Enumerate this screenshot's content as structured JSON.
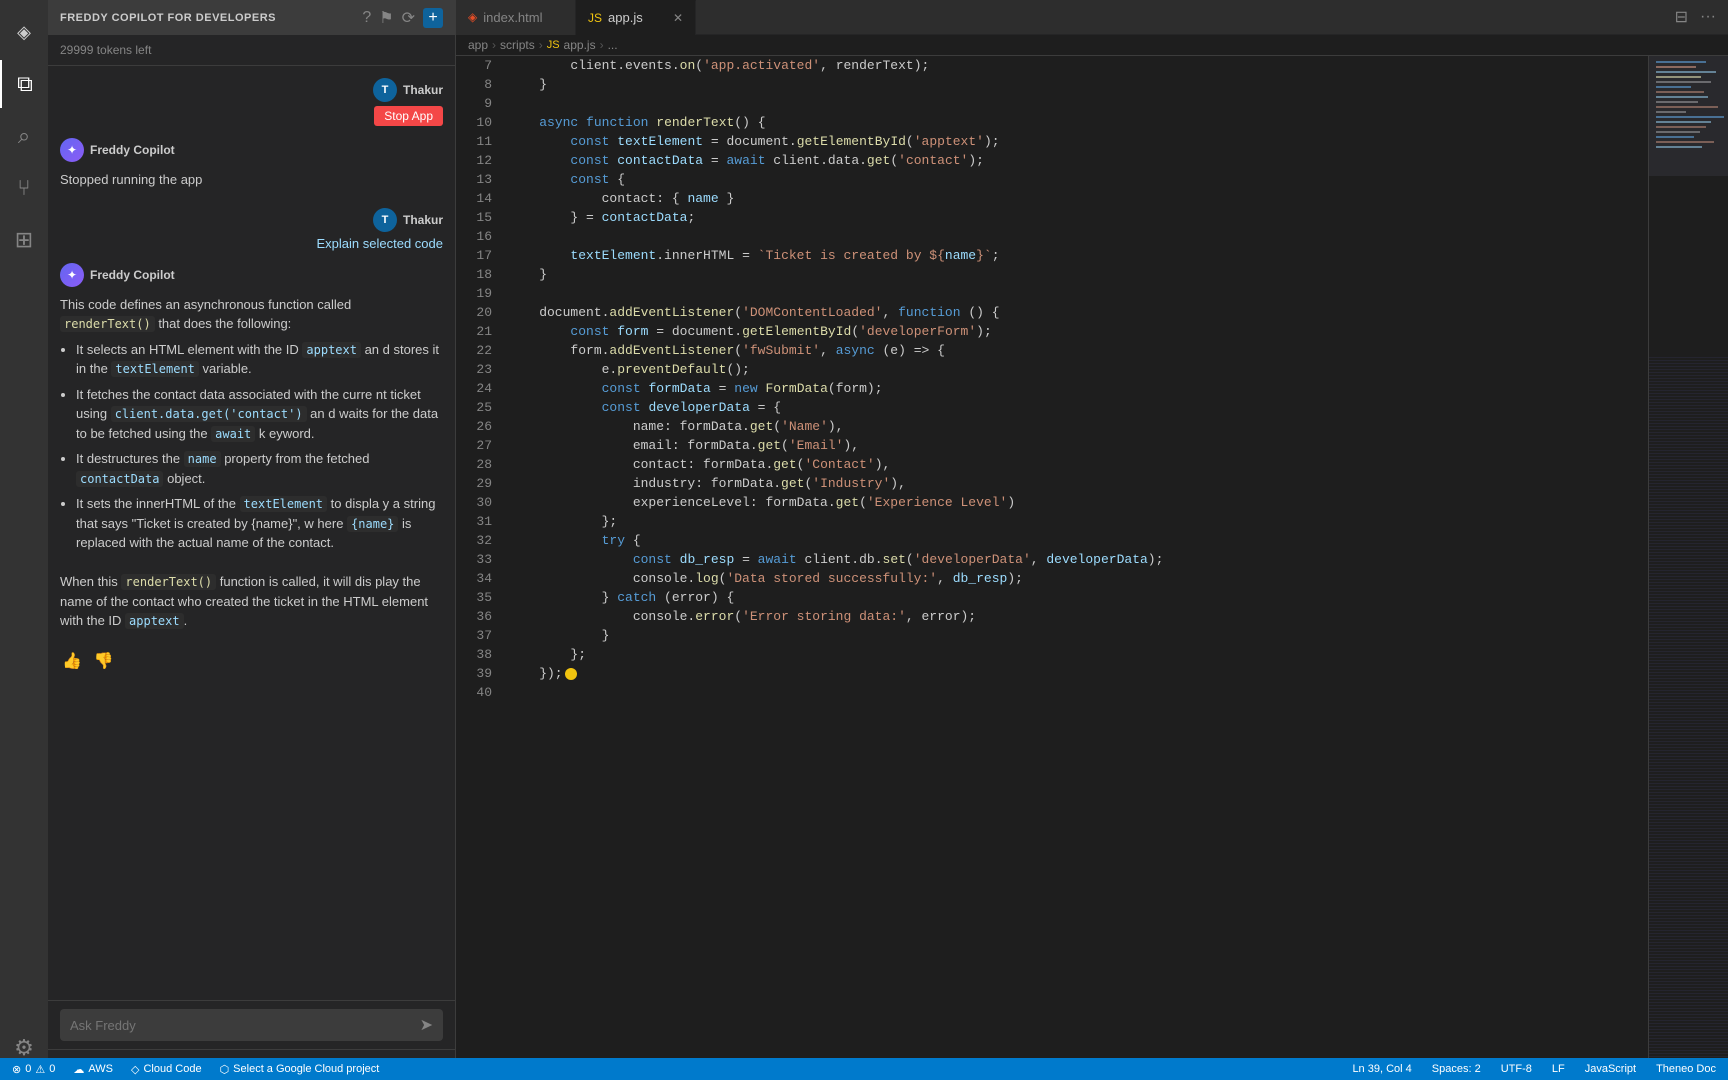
{
  "app": {
    "title": "FREDDY COPILOT FOR DEVELOPERS",
    "tokens_label": "29999 tokens left"
  },
  "activity_bar": {
    "items": [
      {
        "name": "logo",
        "icon": "◈"
      },
      {
        "name": "explorer",
        "icon": "⧉"
      },
      {
        "name": "search",
        "icon": "⌕"
      },
      {
        "name": "source-control",
        "icon": "⑂"
      },
      {
        "name": "extensions",
        "icon": "⊞"
      },
      {
        "name": "settings-bottom",
        "icon": "⚙"
      }
    ]
  },
  "sidebar": {
    "title": "FREDDY COPILOT FOR DEVELOPERS",
    "tokens": "29999 tokens left",
    "messages": [
      {
        "type": "user",
        "avatar": "T",
        "name": "Thakur",
        "action": "Stop App"
      },
      {
        "type": "freddy",
        "name": "Freddy Copilot",
        "content": "Stopped running the app"
      },
      {
        "type": "user",
        "avatar": "T",
        "name": "Thakur",
        "action": "Explain selected code"
      },
      {
        "type": "freddy",
        "name": "Freddy Copilot",
        "intro": "This code defines an asynchronous function called",
        "intro_code": "renderText()",
        "intro_end": " that does the following:",
        "bullets": [
          {
            "text": "It selects an HTML element with the ID",
            "code1": "apptext",
            "mid": "an d stores it in the",
            "code2": "textElement",
            "end": "variable."
          },
          {
            "text": "It fetches the contact data associated with the curre nt ticket using",
            "code1": "client.data.get('contact')",
            "mid": "an d waits for the data to be fetched using the",
            "code2": "await",
            "end": "k eyword."
          },
          {
            "text": "It destructures the",
            "code1": "name",
            "mid": "property from the fetched",
            "code2": "contactData",
            "end": "object."
          },
          {
            "text": "It sets the innerHTML of the",
            "code1": "textElement",
            "mid": "to displa y a string that says \"Ticket is created by {name}\", w here",
            "code2": "{name}",
            "end": "is replaced with the actual name of the contact."
          }
        ],
        "outro1": "When this",
        "outro_code": "renderText()",
        "outro2": "function is called, it will dis play the name of the contact who created the ticket in the HTML element with the ID",
        "outro_code2": "apptext",
        "outro3": "."
      }
    ],
    "ask_placeholder": "Ask Freddy"
  },
  "editor": {
    "tabs": [
      {
        "name": "index.html",
        "type": "html",
        "active": false
      },
      {
        "name": "app.js",
        "type": "js",
        "active": true
      }
    ],
    "breadcrumb": [
      "app",
      "scripts",
      "app.js",
      "..."
    ],
    "lines": [
      {
        "num": 7,
        "tokens": [
          {
            "t": "        client.events.on(",
            "c": "plain"
          },
          {
            "t": "'app.activated'",
            "c": "str"
          },
          {
            "t": ", renderText);",
            "c": "plain"
          }
        ]
      },
      {
        "num": 8,
        "tokens": [
          {
            "t": "    }",
            "c": "plain"
          }
        ]
      },
      {
        "num": 9,
        "tokens": []
      },
      {
        "num": 10,
        "tokens": [
          {
            "t": "    ",
            "c": "plain"
          },
          {
            "t": "async",
            "c": "kw"
          },
          {
            "t": " ",
            "c": "plain"
          },
          {
            "t": "function",
            "c": "kw"
          },
          {
            "t": " ",
            "c": "plain"
          },
          {
            "t": "renderText",
            "c": "fn"
          },
          {
            "t": "() {",
            "c": "plain"
          }
        ]
      },
      {
        "num": 11,
        "tokens": [
          {
            "t": "        ",
            "c": "plain"
          },
          {
            "t": "const",
            "c": "kw"
          },
          {
            "t": " ",
            "c": "plain"
          },
          {
            "t": "textElement",
            "c": "var-name"
          },
          {
            "t": " = document.",
            "c": "plain"
          },
          {
            "t": "getElementById",
            "c": "fn"
          },
          {
            "t": "(",
            "c": "plain"
          },
          {
            "t": "'apptext'",
            "c": "str"
          },
          {
            "t": ");",
            "c": "plain"
          }
        ]
      },
      {
        "num": 12,
        "tokens": [
          {
            "t": "        ",
            "c": "plain"
          },
          {
            "t": "const",
            "c": "kw"
          },
          {
            "t": " ",
            "c": "plain"
          },
          {
            "t": "contactData",
            "c": "var-name"
          },
          {
            "t": " = ",
            "c": "plain"
          },
          {
            "t": "await",
            "c": "kw"
          },
          {
            "t": " client.data.",
            "c": "plain"
          },
          {
            "t": "get",
            "c": "fn"
          },
          {
            "t": "(",
            "c": "plain"
          },
          {
            "t": "'contact'",
            "c": "str"
          },
          {
            "t": ");",
            "c": "plain"
          }
        ]
      },
      {
        "num": 13,
        "tokens": [
          {
            "t": "        ",
            "c": "plain"
          },
          {
            "t": "const",
            "c": "kw"
          },
          {
            "t": " {",
            "c": "plain"
          }
        ]
      },
      {
        "num": 14,
        "tokens": [
          {
            "t": "            contact: { ",
            "c": "plain"
          },
          {
            "t": "name",
            "c": "var-name"
          },
          {
            "t": " }",
            "c": "plain"
          }
        ]
      },
      {
        "num": 15,
        "tokens": [
          {
            "t": "        } = ",
            "c": "plain"
          },
          {
            "t": "contactData",
            "c": "var-name"
          },
          {
            "t": ";",
            "c": "plain"
          }
        ]
      },
      {
        "num": 16,
        "tokens": []
      },
      {
        "num": 17,
        "tokens": [
          {
            "t": "        ",
            "c": "plain"
          },
          {
            "t": "textElement",
            "c": "var-name"
          },
          {
            "t": ".innerHTML = ",
            "c": "plain"
          },
          {
            "t": "`Ticket is created by ${",
            "c": "str"
          },
          {
            "t": "name",
            "c": "var-name"
          },
          {
            "t": "}`",
            "c": "str"
          },
          {
            "t": ";",
            "c": "plain"
          }
        ]
      },
      {
        "num": 18,
        "tokens": [
          {
            "t": "    }",
            "c": "plain"
          }
        ]
      },
      {
        "num": 19,
        "tokens": []
      },
      {
        "num": 20,
        "tokens": [
          {
            "t": "    document.",
            "c": "plain"
          },
          {
            "t": "addEventListener",
            "c": "fn"
          },
          {
            "t": "(",
            "c": "plain"
          },
          {
            "t": "'DOMContentLoaded'",
            "c": "str"
          },
          {
            "t": ", ",
            "c": "plain"
          },
          {
            "t": "function",
            "c": "kw"
          },
          {
            "t": " () {",
            "c": "plain"
          }
        ]
      },
      {
        "num": 21,
        "tokens": [
          {
            "t": "        ",
            "c": "plain"
          },
          {
            "t": "const",
            "c": "kw"
          },
          {
            "t": " ",
            "c": "plain"
          },
          {
            "t": "form",
            "c": "var-name"
          },
          {
            "t": " = document.",
            "c": "plain"
          },
          {
            "t": "getElementById",
            "c": "fn"
          },
          {
            "t": "(",
            "c": "plain"
          },
          {
            "t": "'developerForm'",
            "c": "str"
          },
          {
            "t": ");",
            "c": "plain"
          }
        ]
      },
      {
        "num": 22,
        "tokens": [
          {
            "t": "        form.",
            "c": "plain"
          },
          {
            "t": "addEventListener",
            "c": "fn"
          },
          {
            "t": "(",
            "c": "plain"
          },
          {
            "t": "'fwSubmit'",
            "c": "str"
          },
          {
            "t": ", ",
            "c": "plain"
          },
          {
            "t": "async",
            "c": "kw"
          },
          {
            "t": " (e) => {",
            "c": "plain"
          }
        ]
      },
      {
        "num": 23,
        "tokens": [
          {
            "t": "            e.",
            "c": "plain"
          },
          {
            "t": "preventDefault",
            "c": "fn"
          },
          {
            "t": "();",
            "c": "plain"
          }
        ]
      },
      {
        "num": 24,
        "tokens": [
          {
            "t": "            ",
            "c": "plain"
          },
          {
            "t": "const",
            "c": "kw"
          },
          {
            "t": " ",
            "c": "plain"
          },
          {
            "t": "formData",
            "c": "var-name"
          },
          {
            "t": " = ",
            "c": "plain"
          },
          {
            "t": "new",
            "c": "kw"
          },
          {
            "t": " ",
            "c": "plain"
          },
          {
            "t": "FormData",
            "c": "fn"
          },
          {
            "t": "(form);",
            "c": "plain"
          }
        ]
      },
      {
        "num": 25,
        "tokens": [
          {
            "t": "            ",
            "c": "plain"
          },
          {
            "t": "const",
            "c": "kw"
          },
          {
            "t": " ",
            "c": "plain"
          },
          {
            "t": "developerData",
            "c": "var-name"
          },
          {
            "t": " = {",
            "c": "plain"
          }
        ]
      },
      {
        "num": 26,
        "tokens": [
          {
            "t": "                name: formData.",
            "c": "plain"
          },
          {
            "t": "get",
            "c": "fn"
          },
          {
            "t": "(",
            "c": "plain"
          },
          {
            "t": "'Name'",
            "c": "str"
          },
          {
            "t": "),",
            "c": "plain"
          }
        ]
      },
      {
        "num": 27,
        "tokens": [
          {
            "t": "                email: formData.",
            "c": "plain"
          },
          {
            "t": "get",
            "c": "fn"
          },
          {
            "t": "(",
            "c": "plain"
          },
          {
            "t": "'Email'",
            "c": "str"
          },
          {
            "t": "),",
            "c": "plain"
          }
        ]
      },
      {
        "num": 28,
        "tokens": [
          {
            "t": "                contact: formData.",
            "c": "plain"
          },
          {
            "t": "get",
            "c": "fn"
          },
          {
            "t": "(",
            "c": "plain"
          },
          {
            "t": "'Contact'",
            "c": "str"
          },
          {
            "t": "),",
            "c": "plain"
          }
        ]
      },
      {
        "num": 29,
        "tokens": [
          {
            "t": "                industry: formData.",
            "c": "plain"
          },
          {
            "t": "get",
            "c": "fn"
          },
          {
            "t": "(",
            "c": "plain"
          },
          {
            "t": "'Industry'",
            "c": "str"
          },
          {
            "t": "),",
            "c": "plain"
          }
        ]
      },
      {
        "num": 30,
        "tokens": [
          {
            "t": "                experienceLevel: formData.",
            "c": "plain"
          },
          {
            "t": "get",
            "c": "fn"
          },
          {
            "t": "(",
            "c": "plain"
          },
          {
            "t": "'Experience Level'",
            "c": "str"
          },
          {
            "t": ")",
            "c": "plain"
          }
        ]
      },
      {
        "num": 31,
        "tokens": [
          {
            "t": "            };",
            "c": "plain"
          }
        ]
      },
      {
        "num": 32,
        "tokens": [
          {
            "t": "            ",
            "c": "plain"
          },
          {
            "t": "try",
            "c": "kw"
          },
          {
            "t": " {",
            "c": "plain"
          }
        ]
      },
      {
        "num": 33,
        "tokens": [
          {
            "t": "                ",
            "c": "plain"
          },
          {
            "t": "const",
            "c": "kw"
          },
          {
            "t": " ",
            "c": "plain"
          },
          {
            "t": "db_resp",
            "c": "var-name"
          },
          {
            "t": " = ",
            "c": "plain"
          },
          {
            "t": "await",
            "c": "kw"
          },
          {
            "t": " client.db.",
            "c": "plain"
          },
          {
            "t": "set",
            "c": "fn"
          },
          {
            "t": "(",
            "c": "plain"
          },
          {
            "t": "'developerData'",
            "c": "str"
          },
          {
            "t": ", ",
            "c": "plain"
          },
          {
            "t": "developerData",
            "c": "var-name"
          },
          {
            "t": ");",
            "c": "plain"
          }
        ]
      },
      {
        "num": 34,
        "tokens": [
          {
            "t": "                console.",
            "c": "plain"
          },
          {
            "t": "log",
            "c": "fn"
          },
          {
            "t": "(",
            "c": "plain"
          },
          {
            "t": "'Data stored successfully:'",
            "c": "str"
          },
          {
            "t": ", ",
            "c": "plain"
          },
          {
            "t": "db_resp",
            "c": "var-name"
          },
          {
            "t": ");",
            "c": "plain"
          }
        ]
      },
      {
        "num": 35,
        "tokens": [
          {
            "t": "            } ",
            "c": "plain"
          },
          {
            "t": "catch",
            "c": "kw"
          },
          {
            "t": " (error) {",
            "c": "plain"
          }
        ]
      },
      {
        "num": 36,
        "tokens": [
          {
            "t": "                console.",
            "c": "plain"
          },
          {
            "t": "error",
            "c": "fn"
          },
          {
            "t": "(",
            "c": "plain"
          },
          {
            "t": "'Error storing data:'",
            "c": "str"
          },
          {
            "t": ", error);",
            "c": "plain"
          }
        ]
      },
      {
        "num": 37,
        "tokens": [
          {
            "t": "            }",
            "c": "plain"
          }
        ]
      },
      {
        "num": 38,
        "tokens": [
          {
            "t": "        };",
            "c": "plain"
          }
        ]
      },
      {
        "num": 39,
        "tokens": [
          {
            "t": "    });",
            "c": "plain"
          }
        ],
        "cursor": true
      },
      {
        "num": 40,
        "tokens": []
      }
    ]
  },
  "status_bar": {
    "errors": "⊗ 0",
    "warnings": "⚠ 0",
    "aws": "AWS",
    "cloud_code": "Cloud Code",
    "gcp_project": "Select a Google Cloud project",
    "position": "Ln 39, Col 4",
    "spaces": "Spaces: 2",
    "encoding": "UTF-8",
    "line_ending": "LF",
    "language": "JavaScript",
    "schema": "Theneo Doc"
  }
}
